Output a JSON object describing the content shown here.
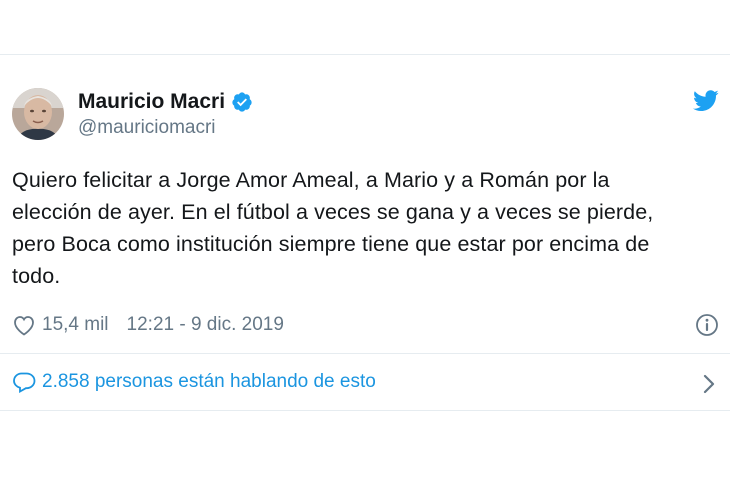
{
  "tweet": {
    "author_name": "Mauricio Macri",
    "author_handle": "@mauriciomacri",
    "text_lines": [
      "Quiero felicitar a Jorge Amor Ameal, a Mario y a Román por la",
      "elección de ayer. En el fútbol a veces se gana y a veces se pierde,",
      "pero Boca como institución siempre tiene que estar por encima de",
      "todo."
    ],
    "likes": "15,4 mil",
    "timestamp": "12:21 - 9 dic. 2019",
    "conversation": "2.858 personas están hablando de esto"
  },
  "icons": {
    "verified": "verified-badge-icon",
    "brand": "twitter-bird-icon",
    "like": "heart-icon",
    "info": "info-icon",
    "reply": "speech-bubble-icon",
    "chevron": "chevron-right-icon"
  },
  "colors": {
    "accent": "#1da1f2",
    "link": "#1b95e0",
    "muted": "#657786",
    "text": "#14171a",
    "border": "#e6ecf0"
  }
}
